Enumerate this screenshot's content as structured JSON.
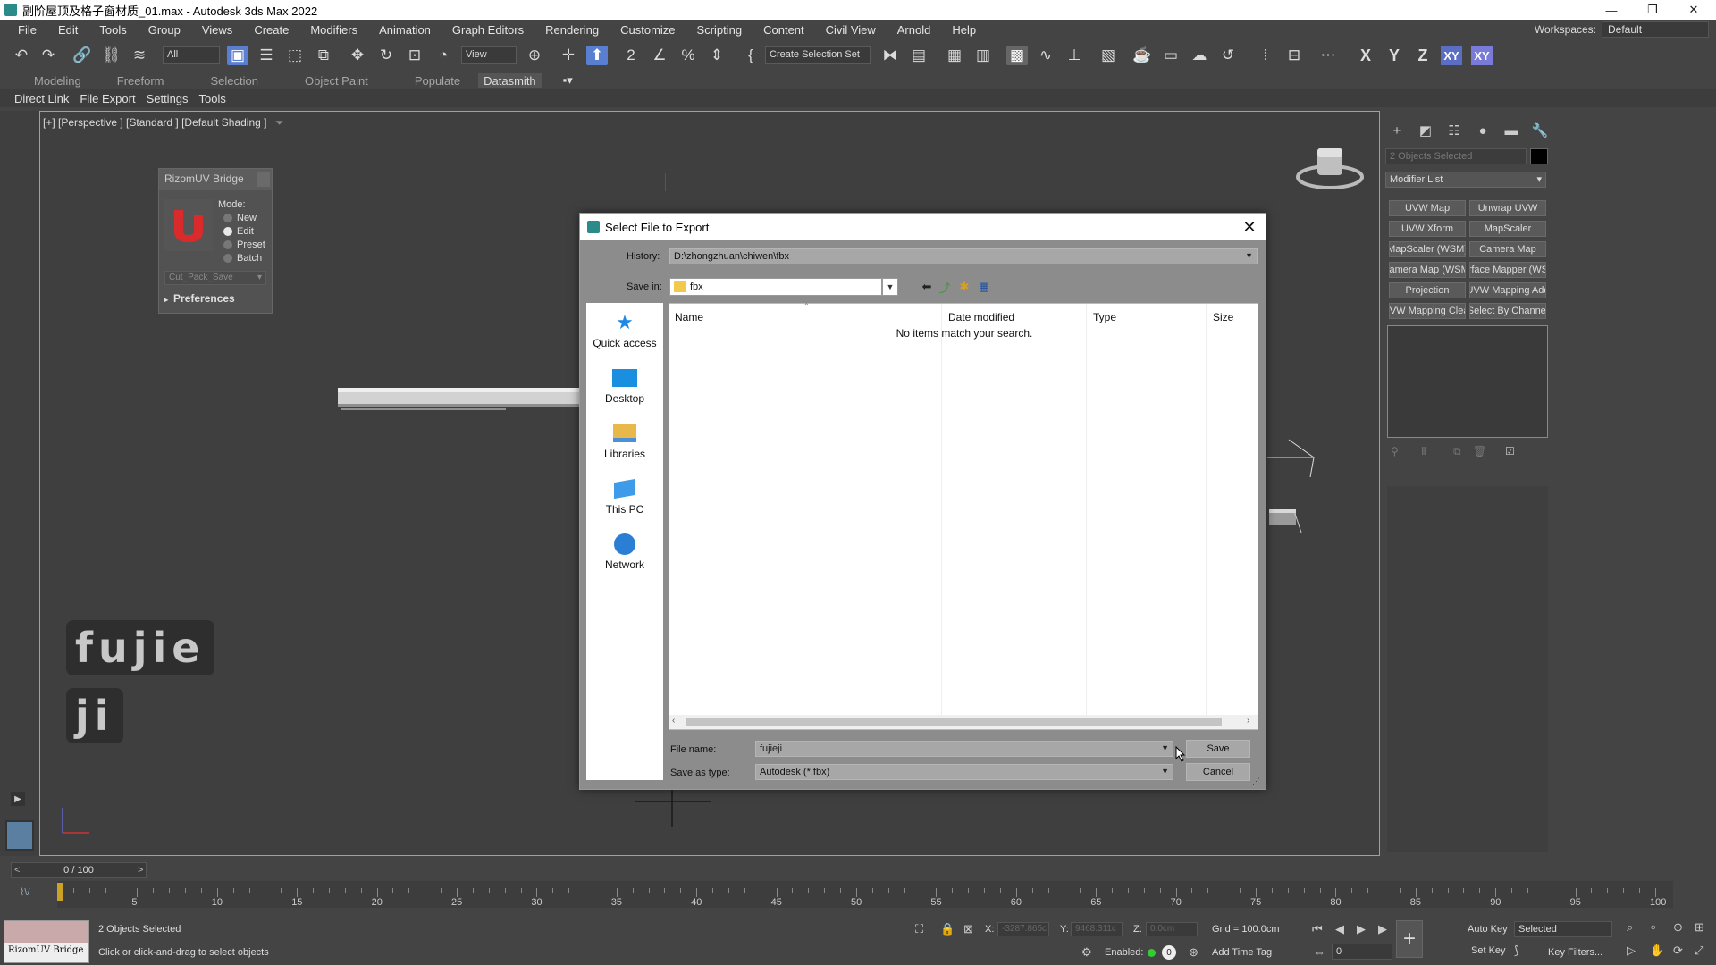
{
  "app": {
    "title": "副阶屋顶及格子窗材质_01.max - Autodesk 3ds Max 2022",
    "workspaces_label": "Workspaces:",
    "workspace_value": "Default"
  },
  "menu": [
    "File",
    "Edit",
    "Tools",
    "Group",
    "Views",
    "Create",
    "Modifiers",
    "Animation",
    "Graph Editors",
    "Rendering",
    "Customize",
    "Scripting",
    "Content",
    "Civil View",
    "Arnold",
    "Help"
  ],
  "toolbar": {
    "filter_value": "All",
    "refcoord_value": "View",
    "selection_set_placeholder": "Create Selection Set",
    "axis": [
      "X",
      "Y",
      "Z",
      "XY",
      "XY"
    ]
  },
  "ribbon_tabs": [
    "Modeling",
    "Freeform",
    "Selection",
    "Object Paint",
    "Populate",
    "Datasmith"
  ],
  "subbar_items": [
    "Direct Link",
    "File Export",
    "Settings",
    "Tools"
  ],
  "viewport": {
    "label": "[+] [Perspective ] [Standard ] [Default Shading ]",
    "watermark_line1": "fujie",
    "watermark_line2": "ji"
  },
  "rizom": {
    "title": "RizomUV Bridge",
    "mode_label": "Mode:",
    "modes": [
      "New",
      "Edit",
      "Preset",
      "Batch"
    ],
    "selected_mode": "Edit",
    "dropdown_value": "Cut_Pack_Save",
    "preferences": "Preferences"
  },
  "dialog": {
    "title": "Select File to Export",
    "history_label": "History:",
    "history_value": "D:\\zhongzhuan\\chiwen\\fbx",
    "save_in_label": "Save in:",
    "save_in_value": "fbx",
    "places": [
      "Quick access",
      "Desktop",
      "Libraries",
      "This PC",
      "Network"
    ],
    "columns": [
      "Name",
      "Date modified",
      "Type",
      "Size"
    ],
    "empty_message": "No items match your search.",
    "file_name_label": "File name:",
    "file_name_value": "fujieji",
    "save_type_label": "Save as type:",
    "save_type_value": "Autodesk (*.fbx)",
    "save_button": "Save",
    "cancel_button": "Cancel"
  },
  "command_panel": {
    "objects_selected": "2 Objects Selected",
    "modifier_list": "Modifier List",
    "modifier_buttons": [
      "UVW Map",
      "Unwrap UVW",
      "UVW Xform",
      "MapScaler",
      "MapScaler (WSM)",
      "Camera Map",
      "Camera Map (WSM)",
      "Surface Mapper (WSM)",
      "Projection",
      "UVW Mapping Add",
      "UVW Mapping Clear",
      "Select By Channel"
    ]
  },
  "timeline": {
    "frame_label": "0 / 100",
    "ticks": [
      "5",
      "10",
      "15",
      "20",
      "25",
      "30",
      "35",
      "40",
      "45",
      "50",
      "55",
      "60",
      "65",
      "70",
      "75",
      "80",
      "85",
      "90",
      "95",
      "100"
    ]
  },
  "statusbar": {
    "rizom_thumb_label": "RizomUV Bridge",
    "objects_selected": "2 Objects Selected",
    "prompt": "Click or click-and-drag to select objects",
    "x_label": "X:",
    "x_value": "-3287.865c",
    "y_label": "Y:",
    "y_value": "9468.311c",
    "z_label": "Z:",
    "z_value": "0.0cm",
    "grid": "Grid = 100.0cm",
    "enabled_label": "Enabled:",
    "add_time_tag": "Add Time Tag",
    "auto_key": "Auto Key",
    "set_key": "Set Key",
    "key_mode_value": "Selected",
    "key_filters": "Key Filters...",
    "frame_value": "0"
  }
}
